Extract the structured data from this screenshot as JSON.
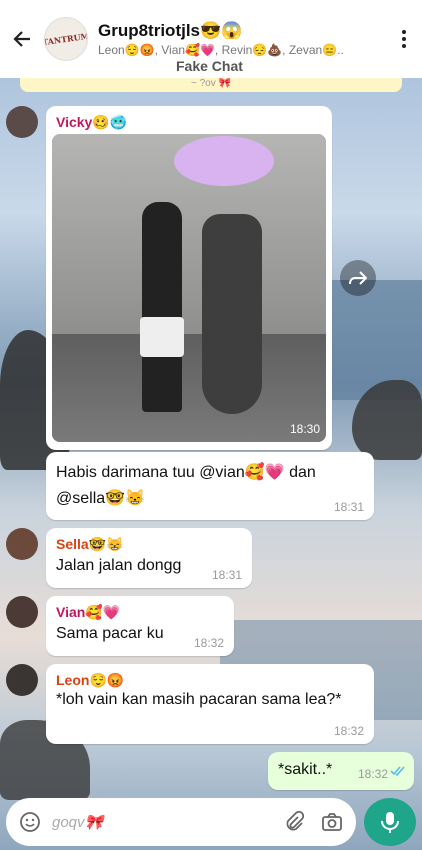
{
  "header": {
    "group_name": "Grup8triotjls😎😱",
    "members": "Leon😌😡, Vian🥰💗, Revin😔💩, Zevan😑..",
    "avatar_text": "TANTRUM"
  },
  "watermark": "Fake Chat",
  "pinned_text": "~ ?ov 🎀",
  "messages": [
    {
      "sender": "Vicky🥴🥶",
      "sender_color": "#c2185b",
      "image_time": "18:30"
    },
    {
      "text": "Habis darimana tuu @vian🥰💗 dan @sella🤓😸",
      "time": "18:31"
    },
    {
      "sender": "Sella🤓😸",
      "sender_color": "#d84315",
      "text": "Jalan jalan dongg",
      "time": "18:31"
    },
    {
      "sender": "Vian🥰💗",
      "sender_color": "#c2185b",
      "text": "Sama pacar ku",
      "time": "18:32"
    },
    {
      "sender": "Leon😌😡",
      "sender_color": "#d84315",
      "text": "*loh vain kan masih pacaran sama lea?*",
      "time": "18:32"
    },
    {
      "text": "*sakit..*",
      "time": "18:32",
      "outgoing": true
    }
  ],
  "input": {
    "placeholder": "ɡoqv🎀"
  },
  "icons": {
    "back": "arrow-left-icon",
    "menu": "more-vert-icon",
    "forward": "forward-icon",
    "emoji": "emoji-icon",
    "attach": "paperclip-icon",
    "camera": "camera-icon",
    "mic": "microphone-icon"
  },
  "colors": {
    "accent": "#1ea58a",
    "outgoing_bubble": "#e7ffdb",
    "read_ticks": "#53bdeb"
  }
}
